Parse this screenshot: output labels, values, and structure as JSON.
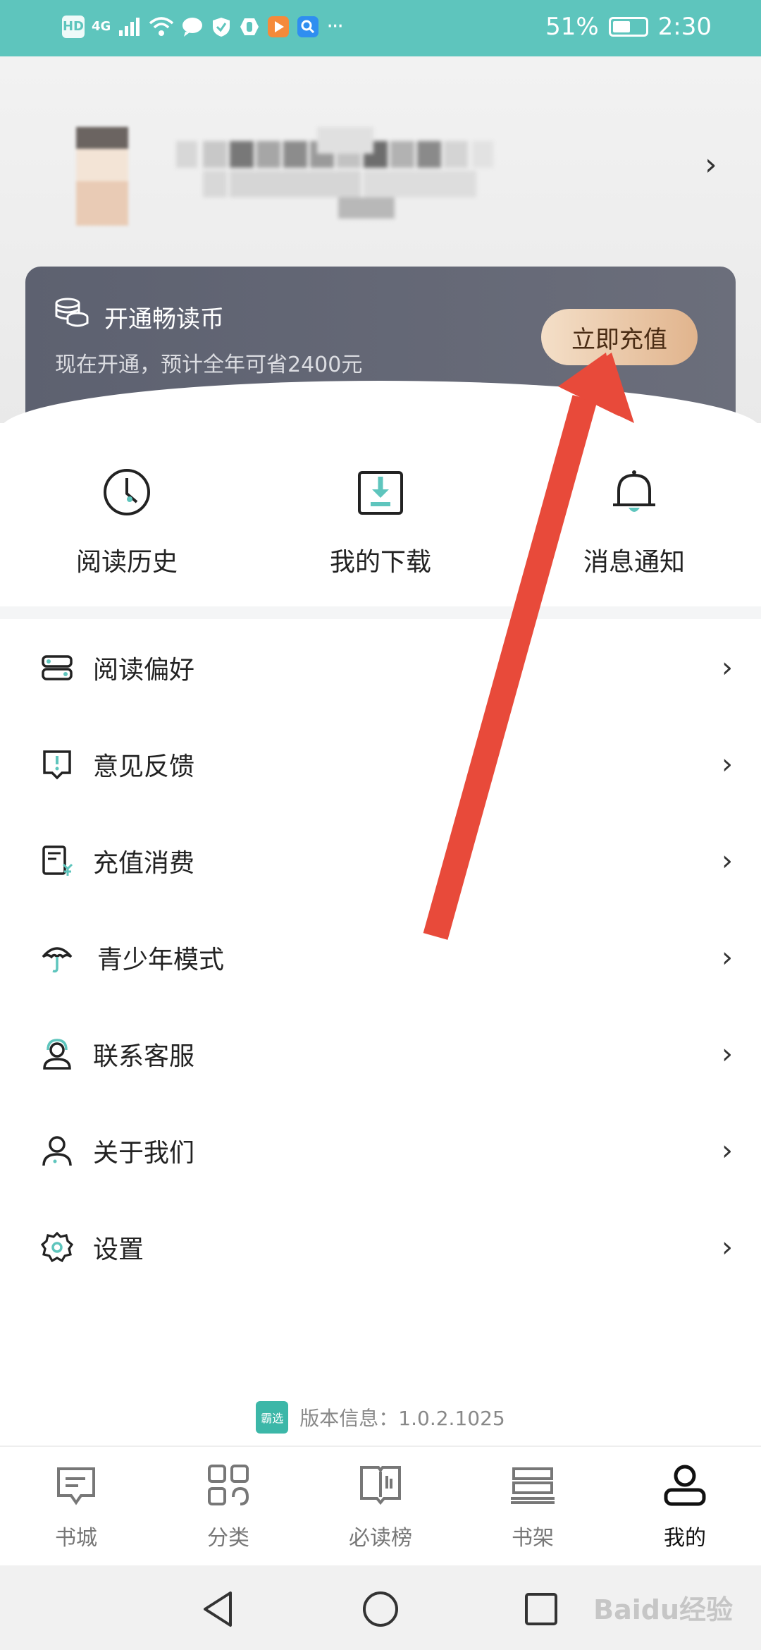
{
  "status_bar": {
    "hd": "HD",
    "network": "4G",
    "battery": "51%",
    "time": "2:30"
  },
  "vip": {
    "title": "开通畅读币",
    "subtitle": "现在开通，预计全年可省2400元",
    "button": "立即充值"
  },
  "quick_actions": [
    {
      "label": "阅读历史",
      "icon": "clock-icon"
    },
    {
      "label": "我的下载",
      "icon": "download-icon"
    },
    {
      "label": "消息通知",
      "icon": "bell-icon"
    }
  ],
  "menu": [
    {
      "label": "阅读偏好",
      "icon": "reading-preference-icon"
    },
    {
      "label": "意见反馈",
      "icon": "feedback-icon"
    },
    {
      "label": "充值消费",
      "icon": "bill-icon"
    },
    {
      "label": "青少年模式",
      "icon": "umbrella-icon"
    },
    {
      "label": "联系客服",
      "icon": "customer-service-icon"
    },
    {
      "label": "关于我们",
      "icon": "person-icon"
    },
    {
      "label": "设置",
      "icon": "gear-icon"
    }
  ],
  "version": {
    "logo_text": "霸选",
    "text": "版本信息：1.0.2.1025"
  },
  "tabs": [
    {
      "label": "书城",
      "icon": "book-city-icon"
    },
    {
      "label": "分类",
      "icon": "category-icon"
    },
    {
      "label": "必读榜",
      "icon": "ranking-icon"
    },
    {
      "label": "书架",
      "icon": "bookshelf-icon"
    },
    {
      "label": "我的",
      "icon": "profile-icon",
      "active": true
    }
  ],
  "watermark": "Baidu经验",
  "colors": {
    "status_bar": "#5ec5bd",
    "accent_teal": "#3cb7a8",
    "vip_card": "#5d6170",
    "recharge_button": "#e1b48d",
    "annotation_arrow": "#e84a3a"
  }
}
